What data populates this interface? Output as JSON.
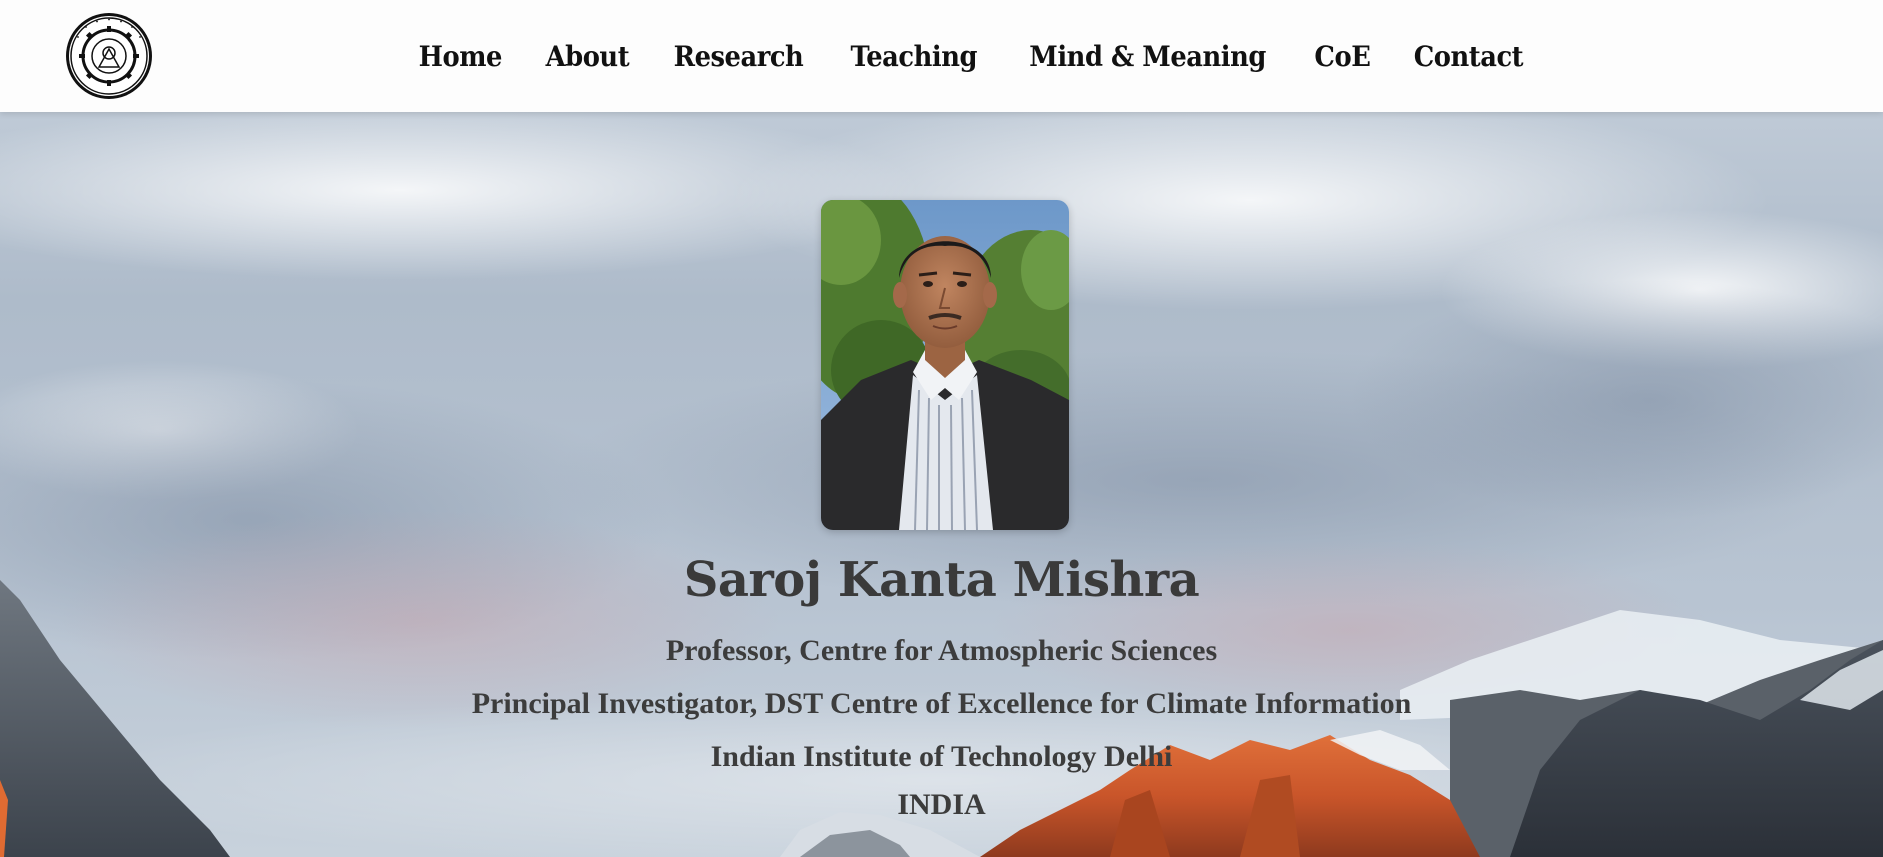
{
  "nav": {
    "items": [
      "Home",
      "About",
      "Research",
      "Teaching",
      "Mind & Meaning",
      "CoE",
      "Contact"
    ]
  },
  "icons": {
    "logo": "iit-delhi-seal-icon"
  },
  "profile": {
    "name": "Saroj Kanta Mishra",
    "title_line1": "Professor, Centre for Atmospheric Sciences",
    "title_line2": "Principal Investigator, DST Centre of Excellence for Climate Information",
    "institute": "Indian Institute of Technology Delhi",
    "country": "INDIA"
  },
  "colors": {
    "header_bg": "#fdfdfd",
    "nav_text": "#111111",
    "profile_text": "#3a3a3a"
  }
}
